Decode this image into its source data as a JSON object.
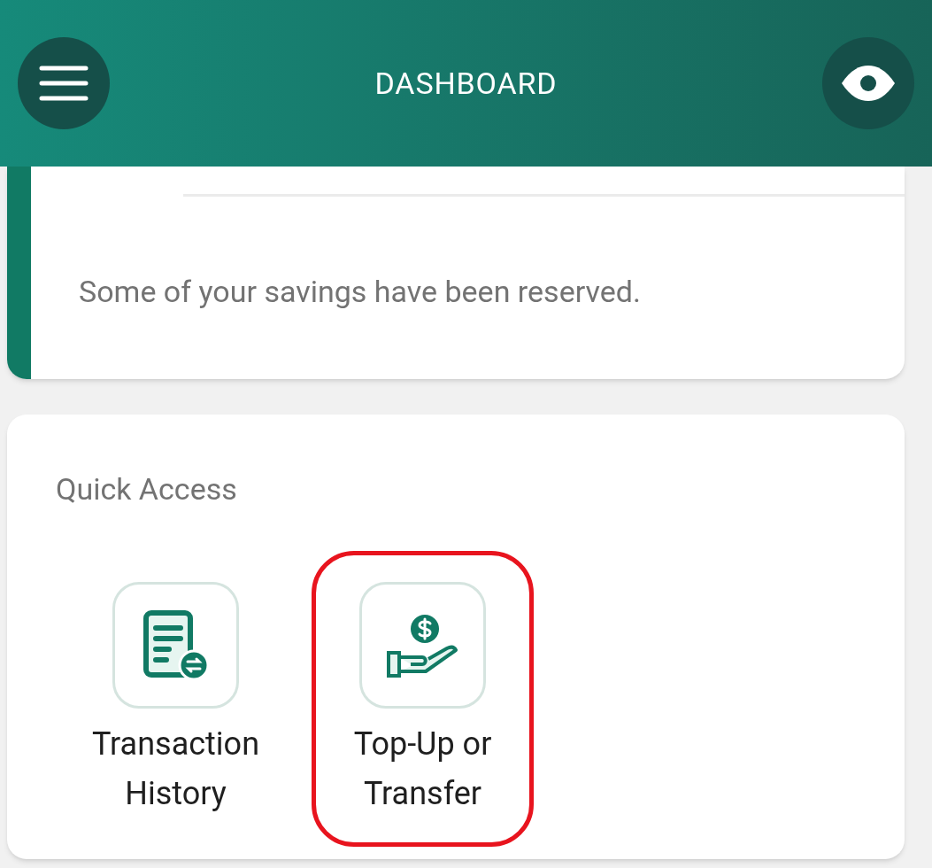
{
  "header": {
    "title": "DASHBOARD"
  },
  "notice": {
    "message": "Some of your savings have been reserved."
  },
  "quick_access": {
    "title": "Quick Access",
    "items": [
      {
        "kind": "history",
        "label": "Transaction History",
        "highlighted": false
      },
      {
        "kind": "topup",
        "label": "Top-Up or Transfer",
        "highlighted": true
      }
    ]
  }
}
